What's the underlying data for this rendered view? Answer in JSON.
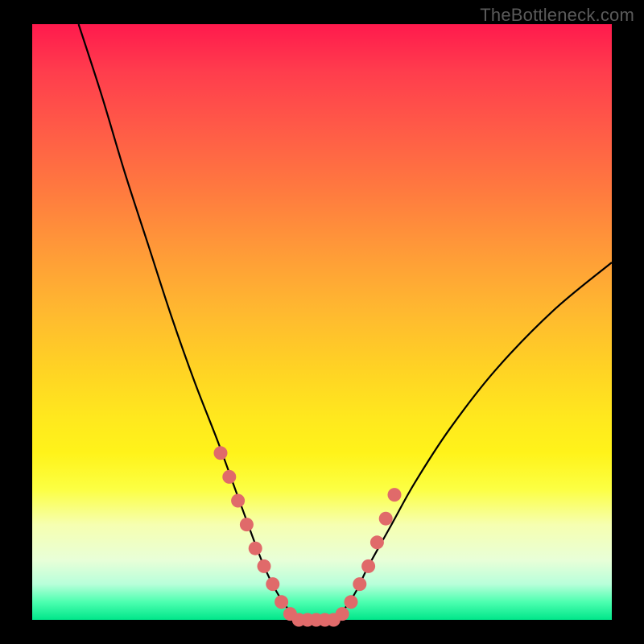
{
  "watermark": "TheBottleneck.com",
  "chart_data": {
    "type": "line",
    "title": "",
    "xlabel": "",
    "ylabel": "",
    "xlim": [
      0,
      100
    ],
    "ylim": [
      0,
      100
    ],
    "series": [
      {
        "name": "bottleneck-curve",
        "x": [
          8,
          12,
          16,
          20,
          24,
          28,
          32,
          35,
          38,
          40,
          42,
          44,
          46,
          48,
          50,
          52,
          54,
          56,
          58,
          62,
          66,
          72,
          80,
          90,
          100
        ],
        "y": [
          100,
          88,
          75,
          63,
          51,
          40,
          30,
          22,
          14,
          9,
          5,
          2,
          0,
          0,
          0,
          0,
          2,
          5,
          9,
          16,
          23,
          32,
          42,
          52,
          60
        ]
      }
    ],
    "markers": {
      "name": "highlight-dots",
      "color": "#e06a6a",
      "x": [
        32.5,
        34,
        35.5,
        37,
        38.5,
        40,
        41.5,
        43,
        44.5,
        46,
        47.5,
        49,
        50.5,
        52,
        53.5,
        55,
        56.5,
        58,
        59.5,
        61,
        62.5
      ],
      "y": [
        28,
        24,
        20,
        16,
        12,
        9,
        6,
        3,
        1,
        0,
        0,
        0,
        0,
        0,
        1,
        3,
        6,
        9,
        13,
        17,
        21
      ]
    },
    "gradient_stops": [
      {
        "pos": 0,
        "color": "#ff1a4d"
      },
      {
        "pos": 50,
        "color": "#ffd324"
      },
      {
        "pos": 80,
        "color": "#fcff42"
      },
      {
        "pos": 100,
        "color": "#00e68a"
      }
    ]
  }
}
